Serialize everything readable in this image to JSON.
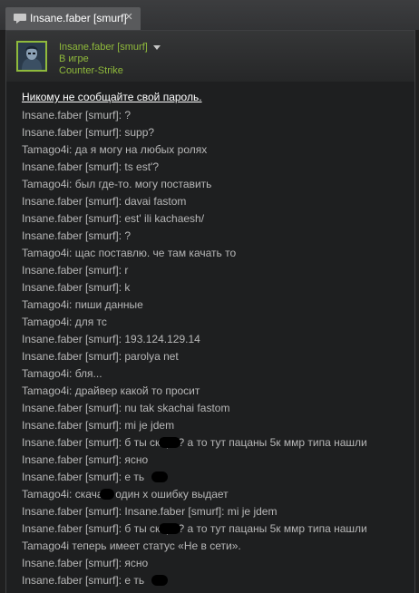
{
  "tab": {
    "title": "Insane.faber [smurf]",
    "close_label": "×"
  },
  "user": {
    "name": "Insane.faber [smurf]",
    "status": "В игре",
    "game": "Counter-Strike"
  },
  "colors": {
    "ingame": "#8fb93b",
    "message": "#b7b7b7",
    "warning": "#ffffff",
    "background": "#1e1f20"
  },
  "chat": {
    "warning": "Никому не сообщайте свой пароль.",
    "messages": [
      "Insane.faber [smurf]: ?",
      "Insane.faber [smurf]: supp?",
      "Tamago4i: да я могу на любых ролях",
      "Insane.faber [smurf]: ts est'?",
      "Tamago4i: был где-то. могу поставить",
      "Insane.faber [smurf]: davai fastom",
      "Insane.faber [smurf]: est' ili kachaesh/",
      "Insane.faber [smurf]: ?",
      "Tamago4i: щас поставлю. че там качать то",
      "Insane.faber [smurf]: r",
      "Insane.faber [smurf]: k",
      "Tamago4i: пиши данные",
      "Tamago4i: для тс",
      "Insane.faber [smurf]: 193.124.129.14",
      "Insane.faber [smurf]: parolya net",
      "Tamago4i: бля...",
      "Tamago4i: драйвер какой то просит",
      "Insane.faber [smurf]: nu tak skachai fastom",
      "Insane.faber [smurf]: mi je jdem",
      "Insane.faber [smurf]: б        ты скоро? а то тут пацаны 5к ммр типа нашли",
      "Insane.faber [smurf]: ясно",
      "Insane.faber [smurf]: е      ть",
      "Tamago4i: скачал. один х     ошибку выдает",
      "Insane.faber [smurf]: Insane.faber [smurf]: mi je jdem",
      "Insane.faber [smurf]: б        ты скоро? а то тут пацаны 5к ммр типа нашли",
      "Tamago4i теперь имеет статус «Не в сети».",
      "Insane.faber [smurf]: ясно",
      "Insane.faber [smurf]: е      ть"
    ]
  }
}
